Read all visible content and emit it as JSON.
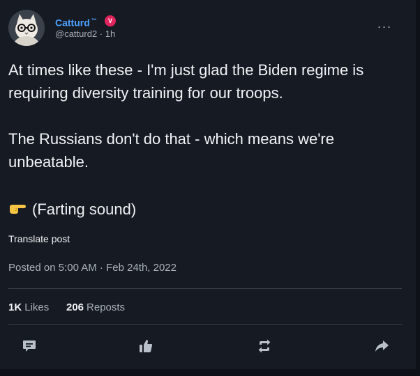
{
  "author": {
    "display_name": "Catturd",
    "trademark": "™",
    "verified_badge": "V",
    "handle": "@catturd2",
    "separator": "·",
    "time_ago": "1h"
  },
  "post": {
    "paragraph_1": "At times like these - I'm just glad the Biden regime is requiring diversity training for our troops.",
    "paragraph_2": "The Russians don't do that - which means we're unbeatable.",
    "paragraph_3": "(Farting sound)",
    "emoji": "pointing-right-hand"
  },
  "translate_label": "Translate post",
  "timestamp": "Posted on 5:00 AM · Feb 24th, 2022",
  "stats": {
    "likes_count": "1K",
    "likes_label": "Likes",
    "reposts_count": "206",
    "reposts_label": "Reposts"
  },
  "actions": [
    "comment-icon",
    "like-icon",
    "repost-icon",
    "share-icon"
  ],
  "colors": {
    "background": "#161a22",
    "name": "#4ea0ff",
    "muted": "#a9b0ba",
    "text": "#f1f3f6",
    "badge": "#e0245e"
  }
}
